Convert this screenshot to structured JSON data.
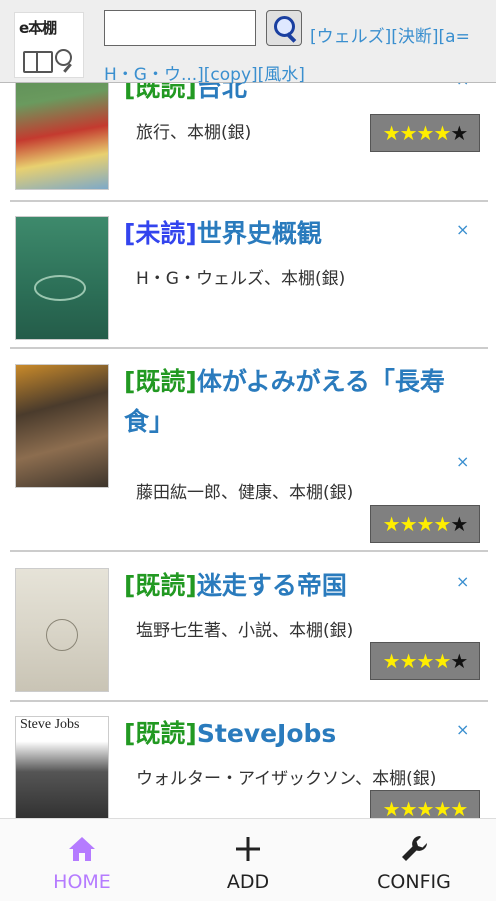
{
  "header": {
    "logo_text": "e本棚",
    "search_value": "",
    "tags": "[ウェルズ][決断][a=H・G・ウ...][copy][風水]"
  },
  "books": [
    {
      "status": "[既読]",
      "title": "台北",
      "meta": "旅行、本棚(銀)",
      "close": "×",
      "rating": 4,
      "stars_on": "★★★★",
      "stars_off": "★",
      "cover_colors": [
        "#6a9a5e",
        "#c43a2f",
        "#e8d070"
      ]
    },
    {
      "status": "[未読]",
      "title": "世界史概観",
      "meta": "H・G・ウェルズ、本棚(銀)",
      "close": "×",
      "rating": null,
      "cover_colors": [
        "#3e8a6c",
        "#2c6f57",
        "#9bc6b0"
      ]
    },
    {
      "status": "[既読]",
      "title": "体がよみがえる「長寿食」",
      "meta": "藤田紘一郎、健康、本棚(銀)",
      "close": "×",
      "rating": 4,
      "stars_on": "★★★★",
      "stars_off": "★",
      "cover_colors": [
        "#4a3b2c",
        "#c98a2a",
        "#8c6d4f"
      ]
    },
    {
      "status": "[既読]",
      "title": "迷走する帝国",
      "meta": "塩野七生著、小説、本棚(銀)",
      "close": "×",
      "rating": 4,
      "stars_on": "★★★★",
      "stars_off": "★",
      "cover_colors": [
        "#d9d5c8",
        "#b8b2a2",
        "#8a8576"
      ]
    },
    {
      "status": "[既読]",
      "title": "SteveJobs",
      "meta": "ウォルター・アイザックソン、本棚(銀)",
      "close": "×",
      "rating": 5,
      "stars_on": "★★★★★",
      "stars_off": "",
      "cover_colors": [
        "#ffffff",
        "#333333",
        "#888888"
      ],
      "cover_text": "Steve Jobs"
    }
  ],
  "nav": {
    "home": "HOME",
    "add": "ADD",
    "config": "CONFIG",
    "active_color": "#b57bff"
  }
}
